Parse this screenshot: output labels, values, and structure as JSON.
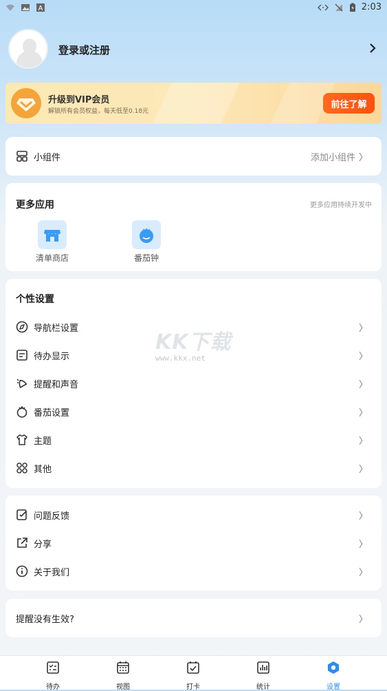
{
  "status_bar": {
    "time": "2:03"
  },
  "profile": {
    "login_text": "登录或注册"
  },
  "vip_banner": {
    "title": "升级到VIP会员",
    "subtitle": "解锁所有会员权益，每天低至0.18元",
    "button": "前往了解"
  },
  "widgets": {
    "label": "小组件",
    "action": "添加小组件"
  },
  "more_apps": {
    "title": "更多应用",
    "note": "更多应用持续开发中",
    "apps": [
      {
        "label": "清单商店",
        "icon": "store-icon"
      },
      {
        "label": "番茄钟",
        "icon": "tomato-icon"
      }
    ]
  },
  "personal_settings": {
    "title": "个性设置",
    "items": [
      {
        "label": "导航栏设置",
        "icon": "navbar-icon"
      },
      {
        "label": "待办显示",
        "icon": "display-icon"
      },
      {
        "label": "提醒和声音",
        "icon": "bell-icon"
      },
      {
        "label": "番茄设置",
        "icon": "tomato-outline-icon"
      },
      {
        "label": "主题",
        "icon": "shirt-icon"
      },
      {
        "label": "其他",
        "icon": "grid-icon"
      }
    ]
  },
  "support": {
    "items": [
      {
        "label": "问题反馈",
        "icon": "feedback-icon"
      },
      {
        "label": "分享",
        "icon": "share-icon"
      },
      {
        "label": "关于我们",
        "icon": "info-icon"
      }
    ]
  },
  "reminder_help": {
    "label": "提醒没有生效?"
  },
  "watermark": {
    "big": "KK下载",
    "small": "www.kkx.net"
  },
  "chevron": "〉",
  "tabs": [
    {
      "label": "待办",
      "icon": "todo-icon",
      "active": false
    },
    {
      "label": "视图",
      "icon": "calendar-icon",
      "active": false
    },
    {
      "label": "打卡",
      "icon": "checkin-icon",
      "active": false
    },
    {
      "label": "统计",
      "icon": "stats-icon",
      "active": false
    },
    {
      "label": "设置",
      "icon": "settings-icon",
      "active": true
    }
  ],
  "colors": {
    "accent": "#2c8cf4",
    "vip_button": "#ff5a14",
    "vip_badge": "#f4a53a"
  }
}
